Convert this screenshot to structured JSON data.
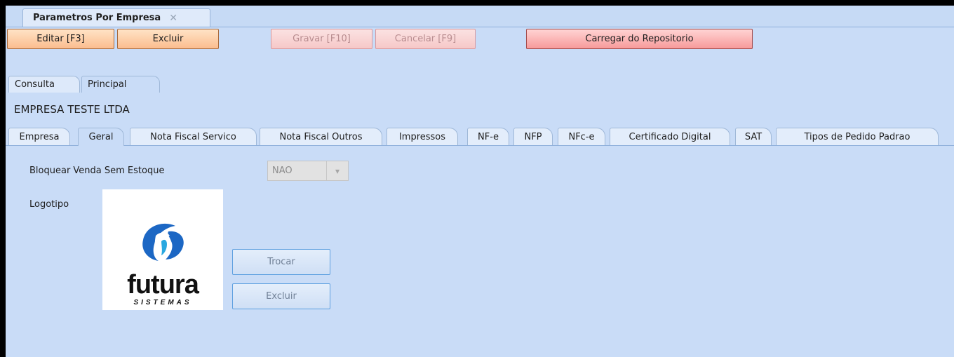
{
  "doc_tab": {
    "title": "Parametros Por Empresa",
    "close": "✕"
  },
  "toolbar": {
    "editar": "Editar [F3]",
    "excluir": "Excluir",
    "gravar": "Gravar [F10]",
    "cancelar": "Cancelar [F9]",
    "carregar": "Carregar do Repositorio"
  },
  "page_tabs": [
    "Consulta",
    "Principal"
  ],
  "company": "EMPRESA TESTE LTDA",
  "sub_tabs": [
    "Empresa",
    "Geral",
    "Nota Fiscal Servico",
    "Nota Fiscal Outros",
    "Impressos",
    "NF-e",
    "NFP",
    "NFc-e",
    "Certificado Digital",
    "SAT",
    "Tipos de Pedido Padrao"
  ],
  "geral": {
    "bloquear_label": "Bloquear Venda Sem Estoque",
    "bloquear_value": "NAO",
    "logotipo_label": "Logotipo",
    "logo_text": "futura",
    "logo_sub": "SISTEMAS",
    "trocar": "Trocar",
    "excluir": "Excluir"
  },
  "colors": {
    "background": "#c9dcf7",
    "button_active": "#fbbd8f",
    "button_disabled": "#f6c8c8",
    "button_repo": "#f79a9a"
  }
}
